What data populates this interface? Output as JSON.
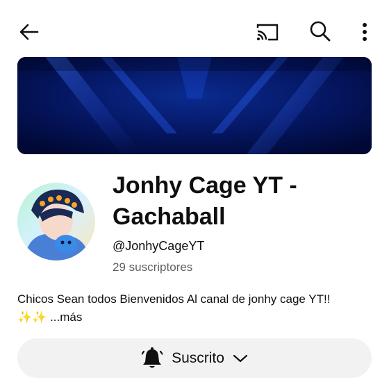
{
  "header": {
    "icons": [
      "back-arrow-icon",
      "cast-icon",
      "search-icon",
      "more-vert-icon"
    ]
  },
  "channel": {
    "title": "Jonhy Cage YT - Gachaball",
    "handle": "@JonhyCageYT",
    "subscribers": "29 suscriptores",
    "description": "Chicos Sean todos Bienvenidos Al canal de jonhy cage YT!!",
    "description_emoji": "✨✨",
    "more_label": "...más"
  },
  "subscribe": {
    "label": "Suscrito",
    "bell_icon": "bell-icon",
    "chevron_icon": "chevron-down-icon"
  },
  "colors": {
    "banner_base": "#000a3a",
    "banner_accent": "#1e4cff",
    "button_bg": "#f2f2f2",
    "secondary_text": "#606060"
  }
}
